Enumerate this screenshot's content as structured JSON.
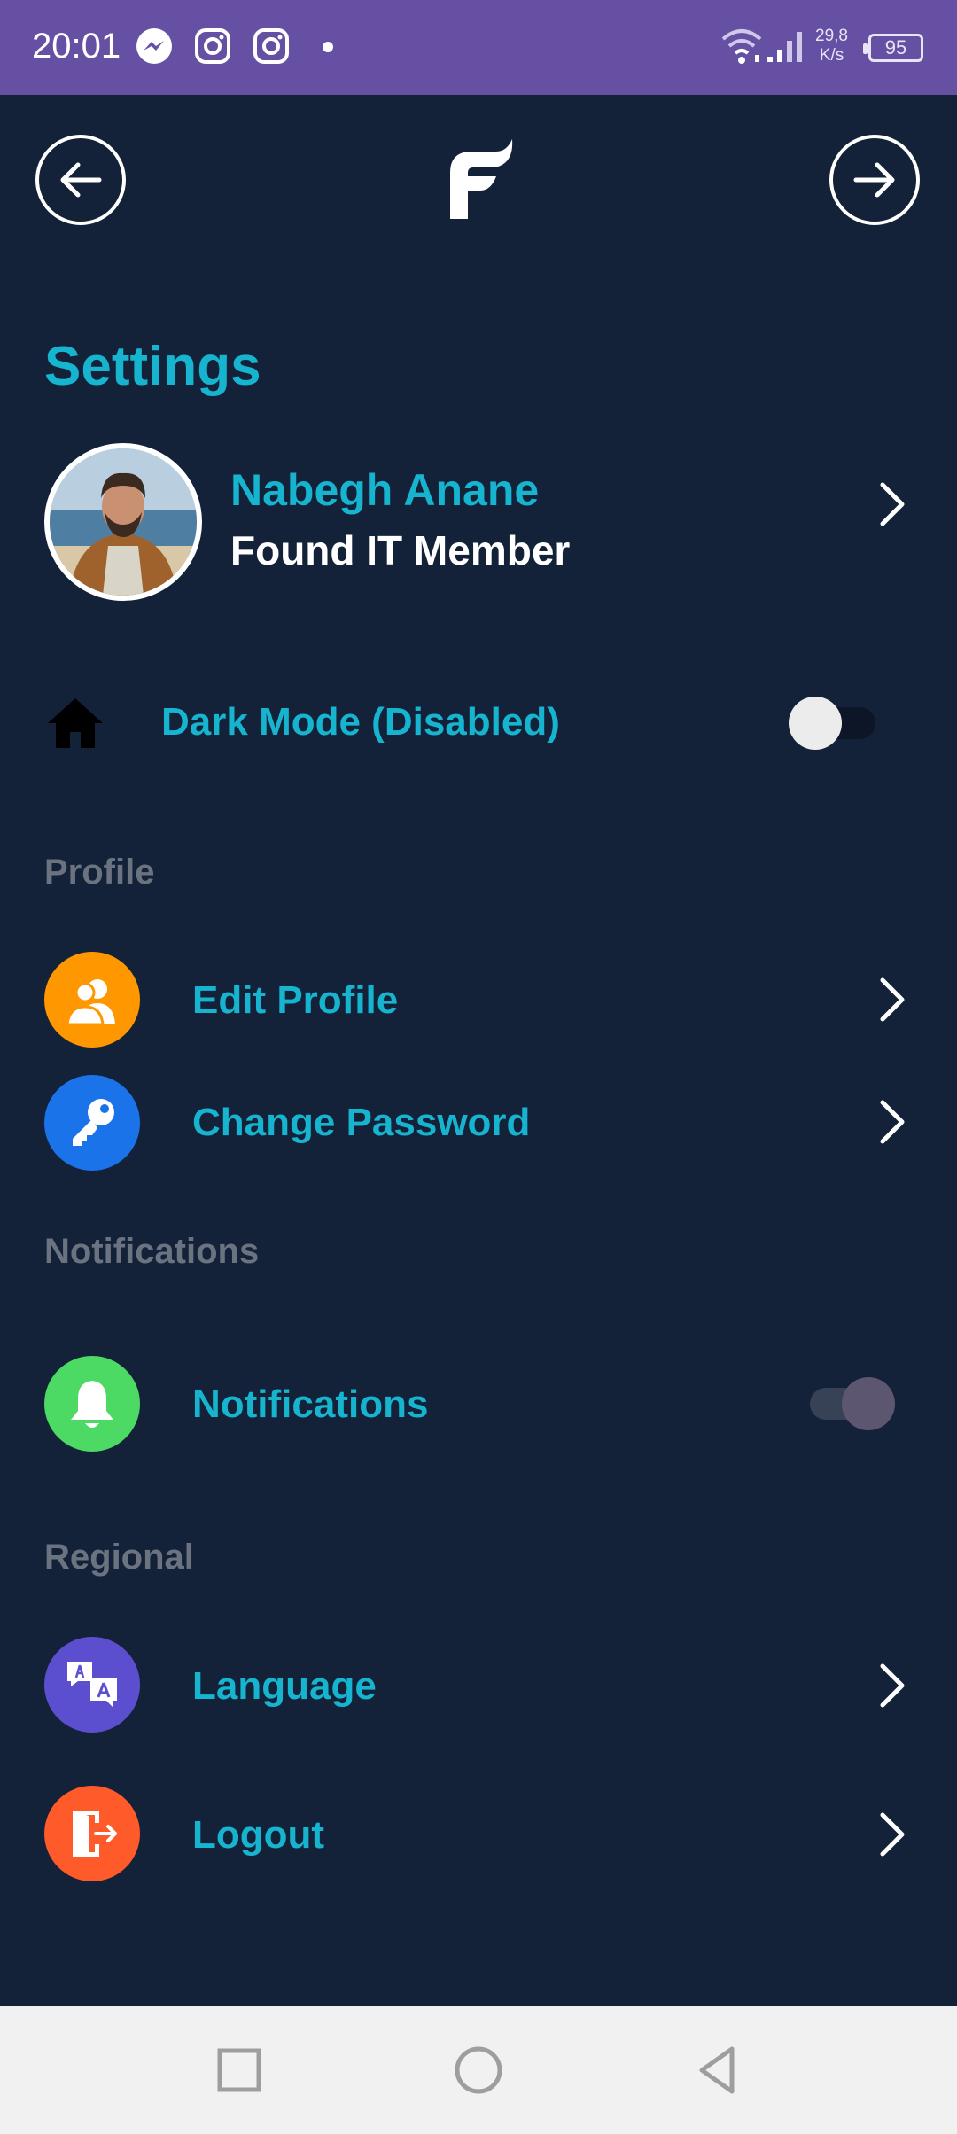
{
  "status_bar": {
    "time": "20:01",
    "icons": [
      "messenger-icon",
      "instagram-icon",
      "instagram-icon",
      "dot-icon",
      "wifi-icon",
      "signal-icon"
    ],
    "net_speed_value": "29,8",
    "net_speed_unit": "K/s",
    "battery": "95",
    "bg_color": "#6650a4"
  },
  "header": {
    "back_icon": "arrow-left-icon",
    "forward_icon": "arrow-right-icon",
    "logo_icon": "app-logo-f"
  },
  "page": {
    "title": "Settings"
  },
  "profile": {
    "name": "Nabegh Anane",
    "role": "Found IT Member"
  },
  "dark_mode": {
    "label": "Dark Mode (Disabled)",
    "enabled": false
  },
  "sections": {
    "profile": "Profile",
    "notifications": "Notifications",
    "regional": "Regional"
  },
  "items": {
    "edit_profile": "Edit Profile",
    "change_password": "Change Password",
    "notifications": "Notifications",
    "language": "Language",
    "logout": "Logout"
  },
  "notifications_toggle": {
    "enabled": true
  },
  "colors": {
    "background": "#132238",
    "accent": "#16b4cf",
    "section": "#6b7280",
    "edit_profile_icon": "#ff9800",
    "change_password_icon": "#1a73e8",
    "notifications_icon": "#4cd964",
    "language_icon": "#5b4fcf",
    "logout_icon": "#ff5a2a"
  }
}
